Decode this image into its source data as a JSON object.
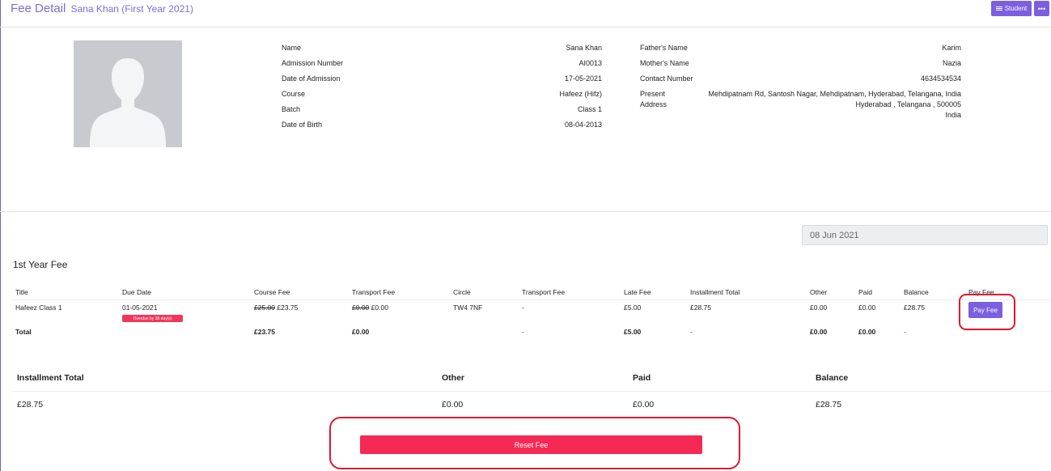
{
  "header": {
    "title": "Fee Detail",
    "subtitle": "Sana Khan (First Year 2021)",
    "student_button": "Student",
    "more_button": "•••"
  },
  "student": {
    "left": [
      {
        "label": "Name",
        "value": "Sana Khan"
      },
      {
        "label": "Admission Number",
        "value": "AI0013"
      },
      {
        "label": "Date of Admission",
        "value": "17-05-2021"
      },
      {
        "label": "Course",
        "value": "Hafeez (Hifz)"
      },
      {
        "label": "Batch",
        "value": "Class 1"
      },
      {
        "label": "Date of Birth",
        "value": "08-04-2013"
      }
    ],
    "right": [
      {
        "label": "Father's Name",
        "value": "Karim"
      },
      {
        "label": "Mother's Name",
        "value": "Nazia"
      },
      {
        "label": "Contact Number",
        "value": "4634534534"
      }
    ],
    "address": {
      "label_line1": "Present",
      "label_line2": "Address",
      "line1": "Mehdipatnam Rd, Santosh Nagar, Mehdipatnam, Hyderabad, Telangana, India",
      "line2": "Hyderabad , Telangana , 500005",
      "line3": "India"
    }
  },
  "date_field": {
    "value": "08 Jun 2021"
  },
  "fee_section": {
    "title": "1st Year Fee",
    "columns": [
      "Title",
      "Due Date",
      "Course Fee",
      "Transport Fee",
      "Circle",
      "Transport Fee",
      "Late Fee",
      "Installment Total",
      "Other",
      "Paid",
      "Balance",
      "Pay Fee"
    ],
    "row": {
      "title": "Hafeez Class 1",
      "due_date": "01-05-2021",
      "overdue_badge": "Overdue by 38 day(s)",
      "course_fee_old": "£25.00",
      "course_fee_new": "£23.75",
      "transport_fee_old": "£0.00",
      "transport_fee_new": "£0.00",
      "circle": "TW4 7NF",
      "transport_fee2": "-",
      "late_fee": "£5.00",
      "installment_total": "£28.75",
      "other": "£0.00",
      "paid": "£0.00",
      "balance": "£28.75",
      "pay_button": "Pay Fee"
    },
    "total": {
      "label": "Total",
      "course_fee": "£23.75",
      "transport_fee": "£0.00",
      "transport_fee2": "-",
      "late_fee": "£5.00",
      "installment_total": "-",
      "other": "£0.00",
      "paid": "£0.00",
      "balance": "-"
    }
  },
  "summary": {
    "headers": [
      "Installment Total",
      "Other",
      "Paid",
      "Balance"
    ],
    "values": [
      "£28.75",
      "£0.00",
      "£0.00",
      "£28.75"
    ]
  },
  "reset_button": "Reset Fee",
  "colors": {
    "accent": "#7b5fe0",
    "danger": "#f52a54",
    "highlight": "#e0192d"
  }
}
